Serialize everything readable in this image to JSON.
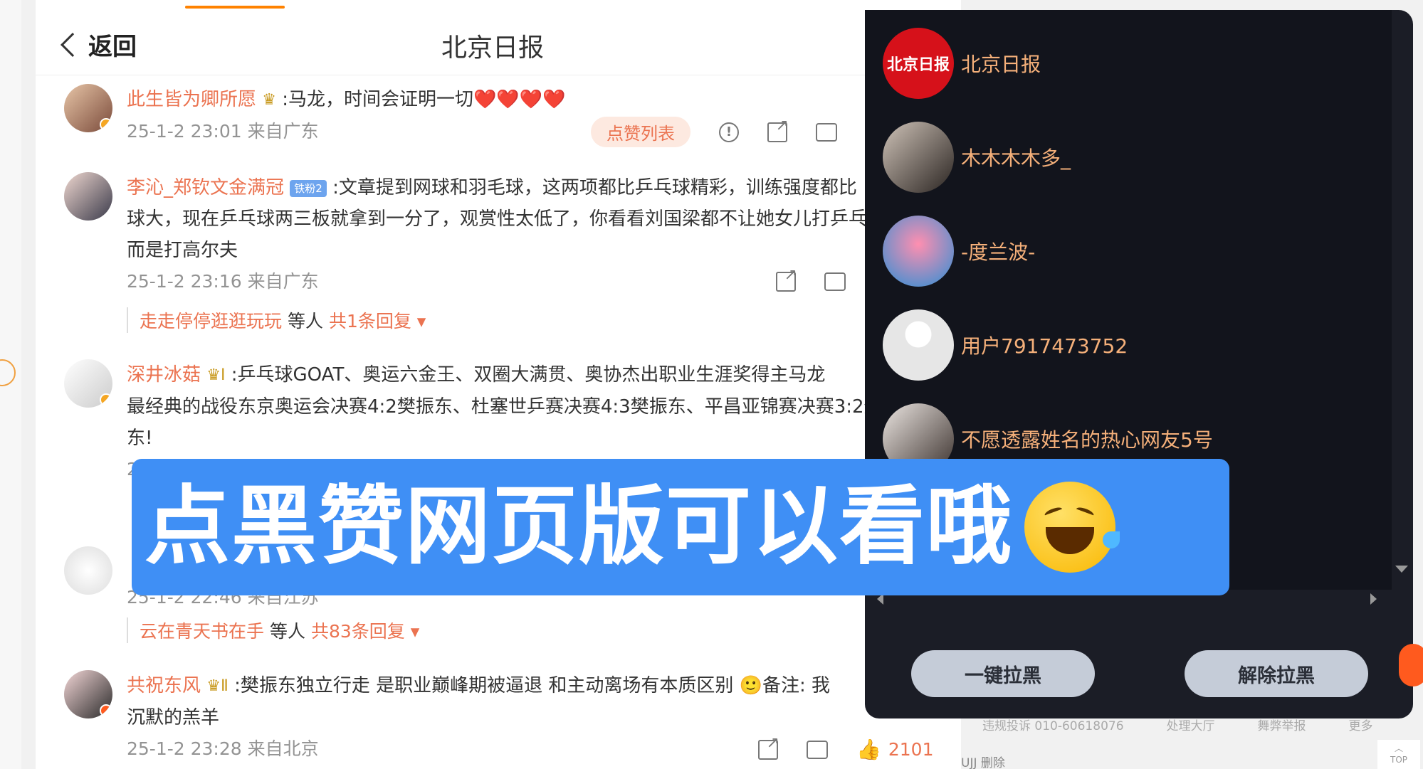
{
  "header": {
    "back_label": "返回",
    "title": "北京日报"
  },
  "comments": [
    {
      "username": "此生皆为卿所愿",
      "text": ":马龙，时间会证明一切❤️❤️❤️❤️",
      "meta": "25-1-2 23:01 来自广东",
      "like_list_label": "点赞列表"
    },
    {
      "username": "李沁_郑钦文金满冠",
      "fan_badge": "铁粉2",
      "text_line1": ":文章提到网球和羽毛球，这两项都比乒乓球精彩，训练强度都比",
      "text_line2": "球大，现在乒乓球两三板就拿到一分了，观赏性太低了，你看看刘国梁都不让她女儿打乒乓",
      "text_line3": "而是打高尔夫",
      "meta": "25-1-2 23:16 来自广东",
      "reply_user": "走走停停逛逛玩玩",
      "reply_mid": "等人",
      "reply_count": "共1条回复"
    },
    {
      "username": "深井冰菇",
      "text_line1": ":乒乓球GOAT、奥运六金王、双圈大满贯、奥协杰出职业生涯奖得主马龙",
      "text_line2": "最经典的战役东京奥运会决赛4:2樊振东、杜塞世乒赛决赛4:3樊振东、平昌亚锦赛决赛3:2樊",
      "text_line3": "东!",
      "partial_meta": "2"
    },
    {
      "partial_meta": "25-1-2 22:46 来自江苏",
      "reply_user": "云在青天书在手",
      "reply_mid": "等人",
      "reply_count": "共83条回复"
    },
    {
      "username": "共祝东风",
      "text_line1": ":樊振东独立行走 是职业巅峰期被逼退 和主动离场有本质区别 🙂备注: 我",
      "text_line2": "沉默的羔羊",
      "meta": "25-1-2 23:28 来自北京",
      "like_count": "2101"
    }
  ],
  "like_panel": {
    "users": [
      {
        "name": "北京日报"
      },
      {
        "name": "木木木木多_"
      },
      {
        "name": "-度兰波-"
      },
      {
        "name": "用户7917473752"
      },
      {
        "name": "不愿透露姓名的热心网友5号"
      }
    ],
    "block_all_label": "一键拉黑",
    "unblock_label": "解除拉黑"
  },
  "footer": {
    "links": [
      "违规投诉 010-60618076",
      "处理大厅",
      "舞弊举报",
      "更多"
    ],
    "row2": "UJJ 删除",
    "top_label": "TOP"
  },
  "banner": {
    "text": "点黑赞网页版可以看哦"
  },
  "colors": {
    "accent": "#eb7350",
    "banner": "#3f8ff5",
    "panel": "#12141c"
  }
}
